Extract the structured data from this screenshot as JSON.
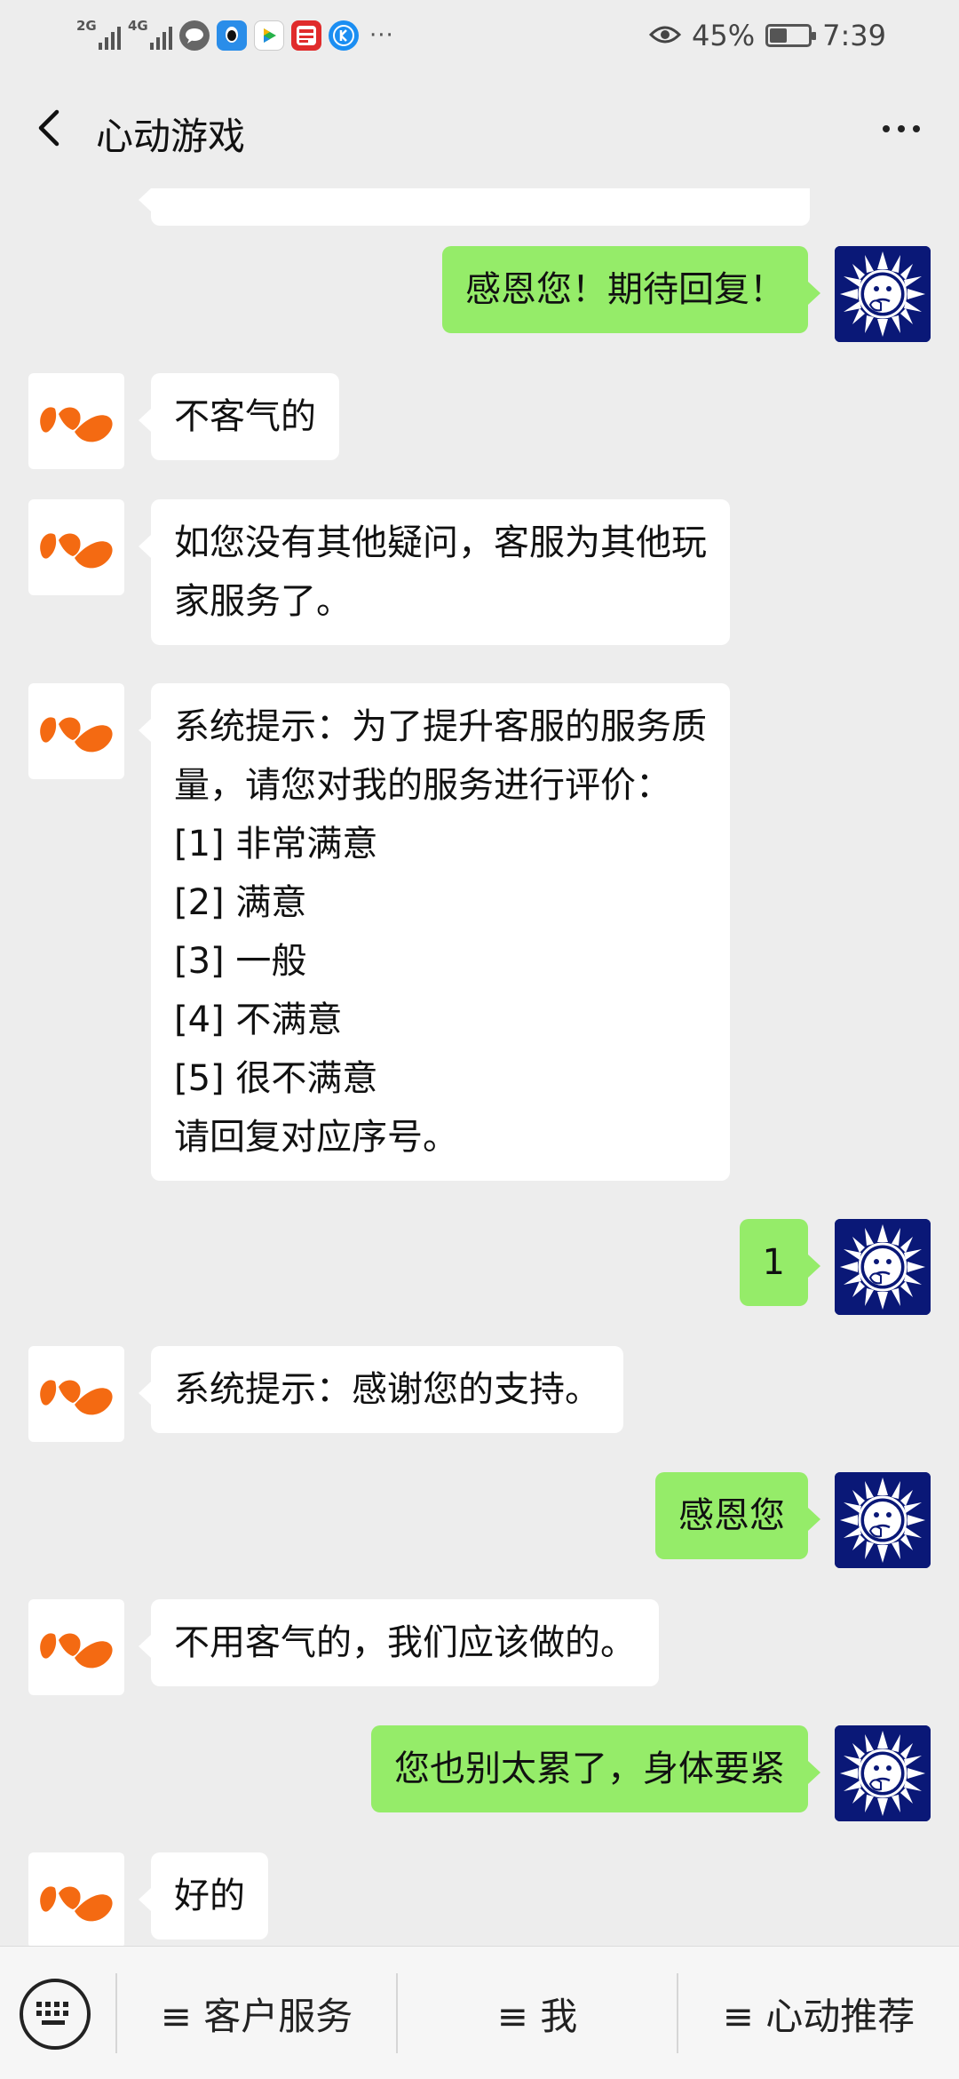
{
  "status_bar": {
    "network_1": "2G",
    "network_2": "4G",
    "overflow": "···",
    "battery_percent": "45%",
    "battery_level": 0.45,
    "time": "7:39"
  },
  "header": {
    "title": "心动游戏"
  },
  "messages": [
    {
      "side": "left",
      "text": ""
    },
    {
      "side": "right",
      "text": "感恩您！期待回复！"
    },
    {
      "side": "left",
      "text": "不客气的"
    },
    {
      "side": "left",
      "text": "如您没有其他疑问，客服为其他玩\n家服务了。"
    },
    {
      "side": "left",
      "text": "系统提示：为了提升客服的服务质\n量，请您对我的服务进行评价：\n[1] 非常满意\n[2] 满意\n[3] 一般\n[4] 不满意\n[5] 很不满意\n请回复对应序号。"
    },
    {
      "side": "right",
      "text": "1"
    },
    {
      "side": "left",
      "text": "系统提示：感谢您的支持。"
    },
    {
      "side": "right",
      "text": "感恩您"
    },
    {
      "side": "left",
      "text": "不用客气的，我们应该做的。"
    },
    {
      "side": "right",
      "text": "您也别太累了，身体要紧"
    },
    {
      "side": "left",
      "text": "好的"
    }
  ],
  "bottom_menu": {
    "items": [
      {
        "label": "≡ 客户服务"
      },
      {
        "label": "≡ 我"
      },
      {
        "label": "≡ 心动推荐"
      }
    ]
  },
  "icons": {
    "back": "back-arrow-icon",
    "more": "more-dots-icon",
    "keyboard": "keyboard-icon",
    "bot_avatar": "xd-logo-icon",
    "user_avatar": "sun-avatar-icon"
  },
  "colors": {
    "background": "#ededed",
    "bubble_sent": "#95ec69",
    "bubble_received": "#ffffff",
    "bot_logo": "#f46a12",
    "user_avatar_bg": "#0a1877"
  }
}
